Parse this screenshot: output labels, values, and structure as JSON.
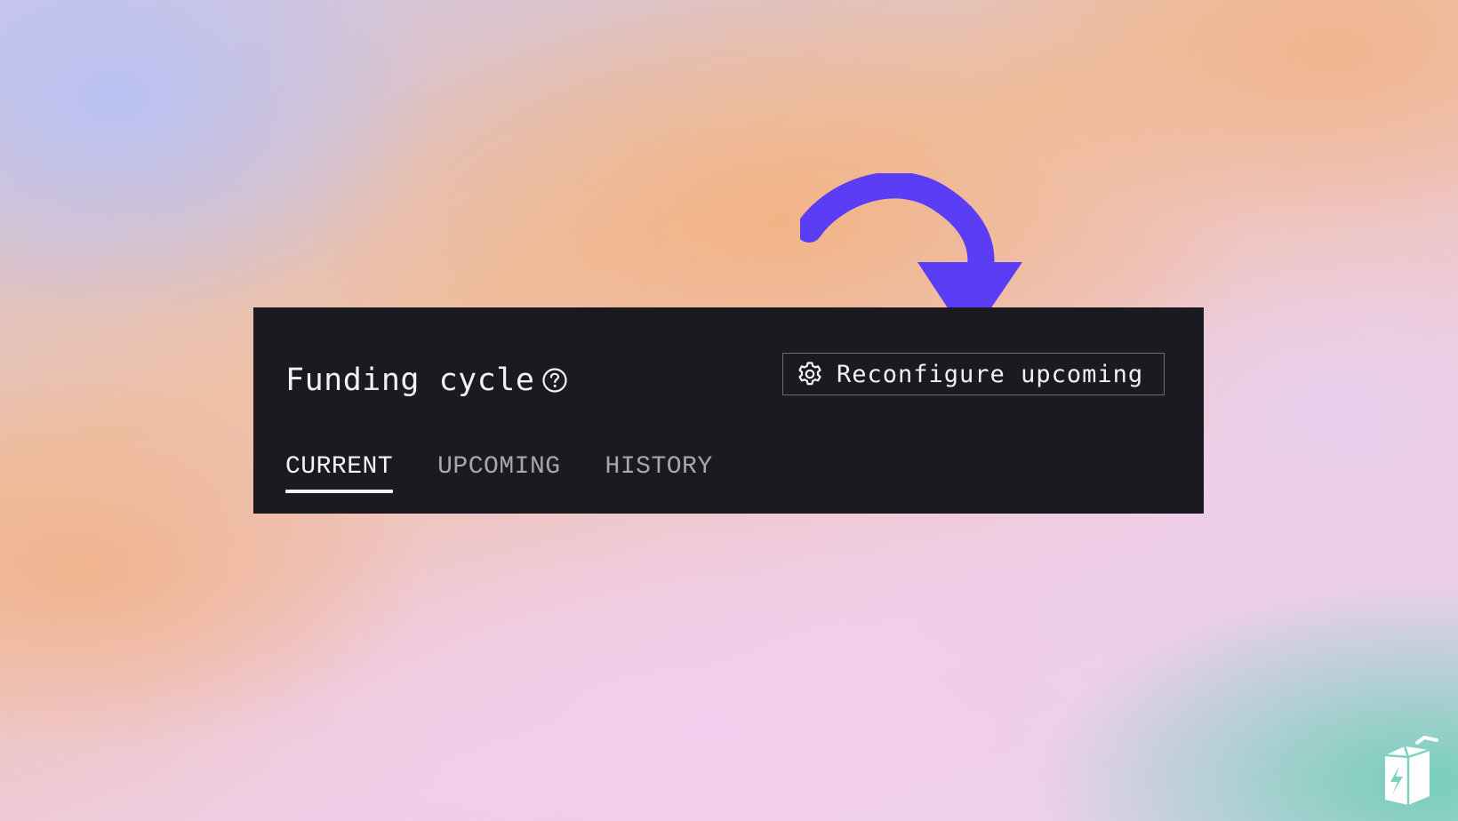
{
  "panel": {
    "title": "Funding cycle",
    "help_icon": "question-circle-icon",
    "reconfigure_button": {
      "label": "Reconfigure upcoming",
      "icon": "gear-icon"
    },
    "tabs": [
      {
        "label": "CURRENT",
        "active": true
      },
      {
        "label": "UPCOMING",
        "active": false
      },
      {
        "label": "HISTORY",
        "active": false
      }
    ]
  },
  "annotation": {
    "icon": "curved-arrow-icon",
    "color": "#5b3df5"
  },
  "brand": {
    "icon": "juicebox-logo-icon"
  },
  "colors": {
    "panel_bg": "#1b1a21",
    "text_primary": "#f2f2f2",
    "text_muted": "#a8a7ae",
    "button_border": "#6c6b72"
  }
}
